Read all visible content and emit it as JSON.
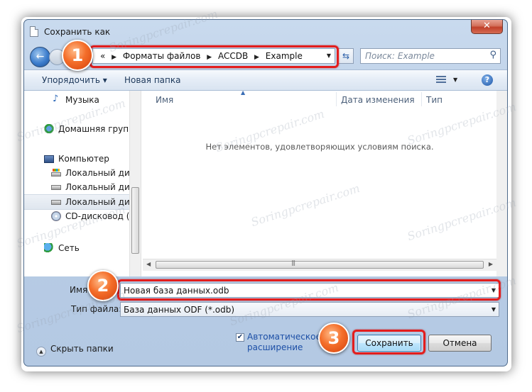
{
  "window": {
    "title": "Сохранить как",
    "close_label": "✕"
  },
  "nav": {
    "breadcrumb": {
      "prefix": "«",
      "items": [
        "Форматы файлов",
        "ACCDB",
        "Example"
      ]
    },
    "search_placeholder": "Поиск: Example"
  },
  "toolbar": {
    "organize_label": "Упорядочить ▾",
    "new_folder_label": "Новая папка",
    "help_label": "?"
  },
  "sidebar": {
    "items": [
      {
        "label": "Музыка",
        "icon": "music-note-icon"
      },
      {
        "label": "Домашняя группа",
        "icon": "homegroup-icon"
      },
      {
        "label": "Компьютер",
        "icon": "computer-icon"
      },
      {
        "label": "Локальный диск",
        "icon": "system-drive-icon"
      },
      {
        "label": "Локальный диск",
        "icon": "drive-icon"
      },
      {
        "label": "Локальный диск",
        "icon": "drive-icon",
        "selected": true
      },
      {
        "label": "CD-дисковод (H",
        "icon": "cd-drive-icon"
      },
      {
        "label": "Сеть",
        "icon": "network-icon"
      }
    ]
  },
  "filelist": {
    "columns": [
      "Имя",
      "Дата изменения",
      "Тип"
    ],
    "empty_message": "Нет элементов, удовлетворяющих условиям поиска."
  },
  "form": {
    "filename_label": "Имя",
    "filename_value": "Новая база данных.odb",
    "filetype_label": "Тип файла:",
    "filetype_value": "База данных ODF (*.odb)",
    "auto_ext_checked": true,
    "auto_ext_label_line1": "Автоматическое",
    "auto_ext_label_line2": "расширение"
  },
  "footer": {
    "hide_folders_label": "Скрыть папки",
    "save_label": "Сохранить",
    "cancel_label": "Отмена"
  },
  "annotations": {
    "badge_1": "1",
    "badge_2": "2",
    "badge_3": "3"
  },
  "watermark": "Soringpcrepair.com",
  "colors": {
    "highlight_red": "#e31d1d",
    "badge_orange": "#f46e2a",
    "window_blue": "#c9daee"
  }
}
